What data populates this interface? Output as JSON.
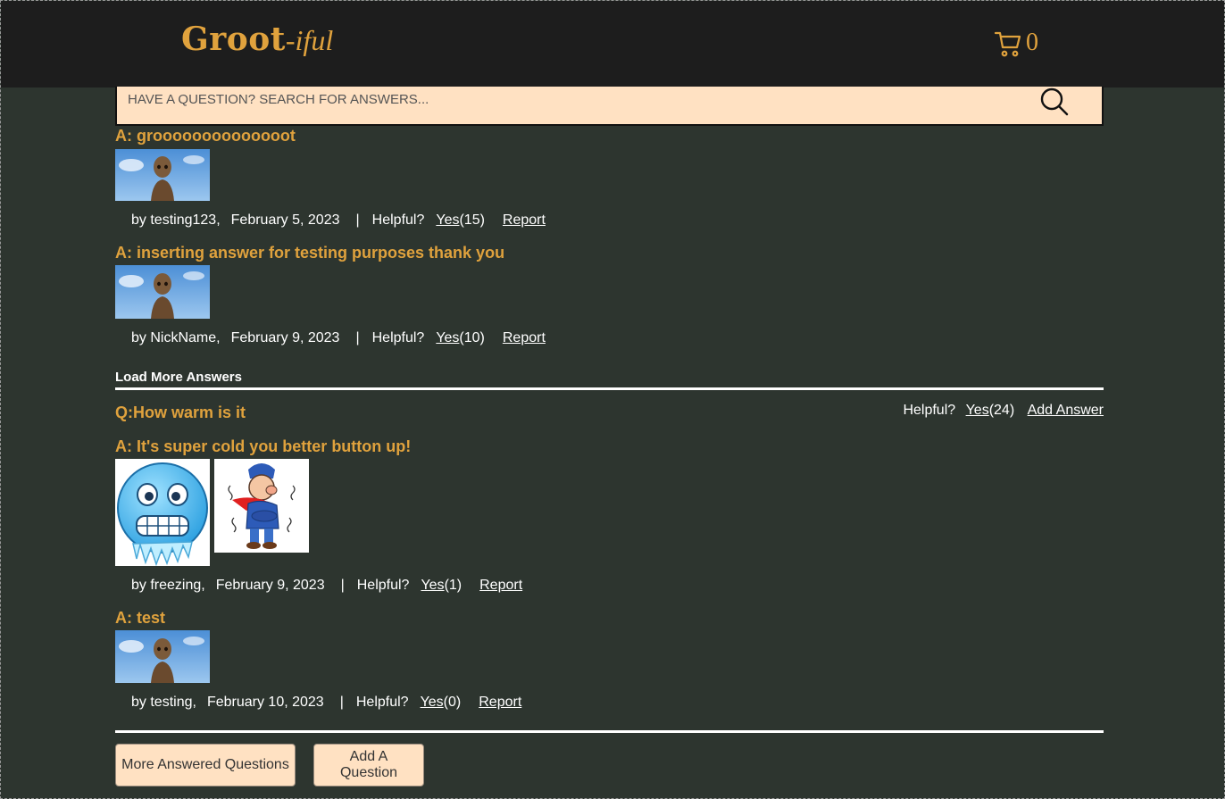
{
  "header": {
    "brand_main": "Groot",
    "brand_sub": "-iful",
    "cart_icon": "shopping-cart-icon",
    "cart_count": "0"
  },
  "search": {
    "placeholder": "HAVE A QUESTION? SEARCH FOR ANSWERS...",
    "icon": "search-icon"
  },
  "answers_top": [
    {
      "title": "A: groooooooooooooot",
      "by_prefix": "by",
      "user": "testing123,",
      "date": "February 5, 2023",
      "separator": "|",
      "helpful_label": "Helpful?",
      "yes_label": "Yes",
      "count": "(15)",
      "report_label": "Report"
    },
    {
      "title": "A: inserting answer for testing purposes thank you",
      "by_prefix": "by",
      "user": "NickName,",
      "date": "February 9, 2023",
      "separator": "|",
      "helpful_label": "Helpful?",
      "yes_label": "Yes",
      "count": "(10)",
      "report_label": "Report"
    }
  ],
  "load_more_label": "Load More Answers",
  "question": {
    "title": "Q:How warm is it",
    "helpful_label": "Helpful?",
    "yes_label": "Yes",
    "count": "(24)",
    "add_answer_label": "Add Answer"
  },
  "answers_bottom": [
    {
      "title": "A: It's super cold you better button up!",
      "by_prefix": "by",
      "user": "freezing,",
      "date": "February 9, 2023",
      "separator": "|",
      "helpful_label": "Helpful?",
      "yes_label": "Yes",
      "count": "(1)",
      "report_label": "Report"
    },
    {
      "title": "A: test",
      "by_prefix": "by",
      "user": "testing,",
      "date": "February 10, 2023",
      "separator": "|",
      "helpful_label": "Helpful?",
      "yes_label": "Yes",
      "count": "(0)",
      "report_label": "Report"
    }
  ],
  "buttons": {
    "more_questions": "More Answered Questions",
    "add_question": "Add A Question"
  },
  "colors": {
    "accent": "#e0a23d",
    "background": "#2d352f",
    "navbar": "#1d1d1d",
    "input_bg": "#ffe1c2"
  }
}
